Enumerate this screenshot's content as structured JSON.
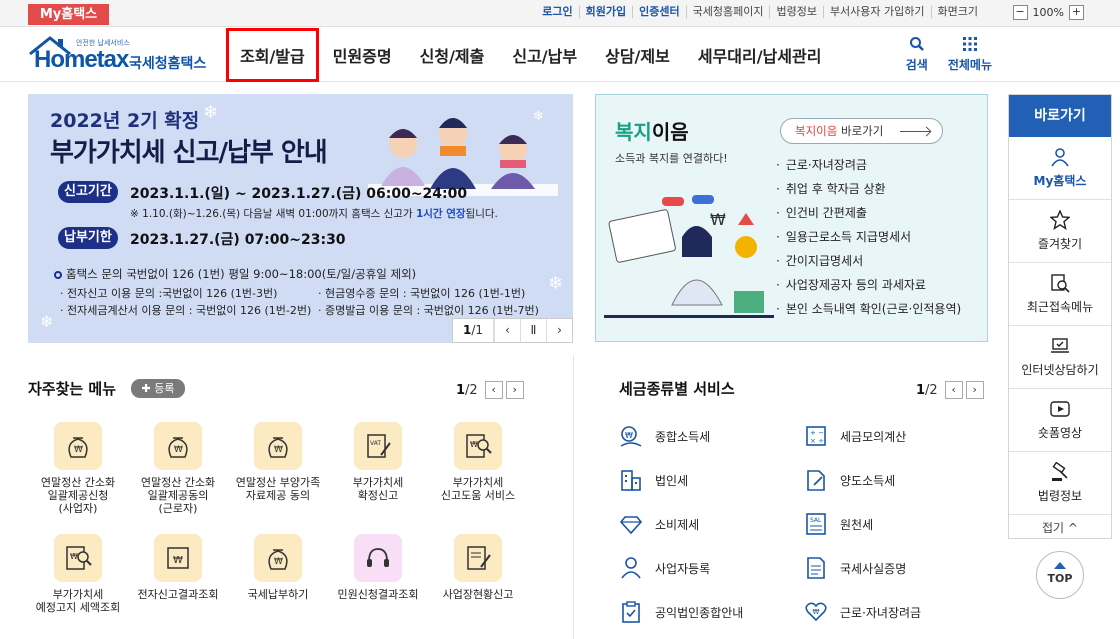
{
  "topbar": {
    "my_hometax": "My홈택스",
    "links": [
      "로그인",
      "회원가입",
      "인증센터",
      "국세청홈페이지",
      "법령정보",
      "부서사용자 가입하기",
      "화면크기"
    ],
    "zoom_minus": "−",
    "zoom_value": "100%",
    "zoom_plus": "+"
  },
  "logo": {
    "small": "안전한 납세서비스",
    "word": "Hometax",
    "ko": "국세청홈택스"
  },
  "nav": [
    "조회/발급",
    "민원증명",
    "신청/제출",
    "신고/납부",
    "상담/제보",
    "세무대리/납세관리"
  ],
  "header_right": {
    "search": "검색",
    "all_menu": "전체메뉴"
  },
  "hero": {
    "title1": "2022년 2기 확정",
    "title2": "부가가치세 신고/납부 안내",
    "report_period_label": "신고기간",
    "report_period": "2023.1.1.(일) ~ 2023.1.27.(금) 06:00~24:00",
    "note_pre": "※ 1.10.(화)~1.26.(목) 다음날 새벽 01:00까지 홈택스 신고가 ",
    "note_em": "1시간 연장",
    "note_post": "됩니다.",
    "pay_period_label": "납부기한",
    "pay_period": "2023.1.27.(금) 07:00~23:30",
    "info_main": "홈택스 문의 국번없이 126 (1번) 평일 9:00~18:00(토/일/공휴일 제외)",
    "info1": "· 전자신고 이용 문의 :국번없이 126 (1번-3번)",
    "info2": "· 현금영수증 문의 : 국번없이 126 (1번-1번)",
    "info3": "· 전자세금계산서 이용 문의 : 국번없이 126 (1번-2번)",
    "info4": "· 증명발급 이용 문의 : 국번없이 126 (1번-7번)",
    "counter_current": "1",
    "counter_total": "/1",
    "prev": "‹",
    "pause": "Ⅱ",
    "next": "›"
  },
  "welfare": {
    "title_green": "복지",
    "title_rest": "이음",
    "subtitle": "소득과 복지를 연결하다!",
    "go_red": "복지이음",
    "go_rest": " 바로가기",
    "items": [
      "근로·자녀장려금",
      "취업 후 학자금 상환",
      "인건비 간편제출",
      "일용근로소득 지급명세서",
      "간이지급명세서",
      "사업장제공자 등의 과세자료",
      "본인 소득내역 확인(근로·인적용역)"
    ]
  },
  "quick": {
    "head": "바로가기",
    "items": [
      "My홈택스",
      "즐겨찾기",
      "최근접속메뉴",
      "인터넷상담하기",
      "숏폼영상",
      "법령정보"
    ],
    "fold": "접기 ^",
    "top": "TOP"
  },
  "favorites": {
    "title": "자주찾는 메뉴",
    "register": "✚ 등록",
    "page_current": "1",
    "page_total": "/2",
    "items": [
      {
        "label": "연말정산 간소화\n일괄제공신청\n(사업자)"
      },
      {
        "label": "연말정산 간소화\n일괄제공동의\n(근로자)"
      },
      {
        "label": "연말정산 부양가족\n자료제공 동의"
      },
      {
        "label": "부가가치세\n확정신고"
      },
      {
        "label": "부가가치세\n신고도움 서비스"
      },
      {
        "label": "부가가치세\n예정고지 세액조회"
      },
      {
        "label": "전자신고결과조회"
      },
      {
        "label": "국세납부하기"
      },
      {
        "label": "민원신청결과조회"
      },
      {
        "label": "사업장현황신고"
      }
    ]
  },
  "tax_services": {
    "title": "세금종류별 서비스",
    "page_current": "1",
    "page_total": "/2",
    "left": [
      "종합소득세",
      "법인세",
      "소비제세",
      "사업자등록",
      "공익법인종합안내"
    ],
    "right": [
      "세금모의계산",
      "양도소득세",
      "원천세",
      "국세사실증명",
      "근로·자녀장려금"
    ]
  }
}
